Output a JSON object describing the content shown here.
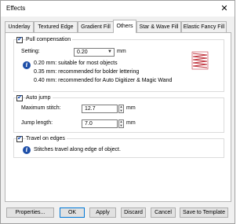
{
  "window": {
    "title": "Effects",
    "close_glyph": "✕"
  },
  "tabs": [
    {
      "label": "Underlay"
    },
    {
      "label": "Textured Edge"
    },
    {
      "label": "Gradient Fill"
    },
    {
      "label": "Others"
    },
    {
      "label": "Star & Wave Fill"
    },
    {
      "label": "Elastic Fancy Fill"
    }
  ],
  "active_tab": "Others",
  "pull_compensation": {
    "checkbox_label": "Pull compensation",
    "checked": true,
    "setting_label": "Setting:",
    "setting_value": "0.20",
    "unit": "mm",
    "info_lines": [
      "0.20 mm: suitable for most objects",
      "0.35 mm: recommended for bolder lettering",
      "0.40 mm: recommended for Auto Digitizer & Magic Wand"
    ],
    "preview_icon": "zigzag-stitch-preview-icon"
  },
  "auto_jump": {
    "checkbox_label": "Auto jump",
    "checked": true,
    "max_stitch_label": "Maximum stitch:",
    "max_stitch_value": "12.7",
    "jump_length_label": "Jump length:",
    "jump_length_value": "7.0",
    "unit": "mm"
  },
  "travel_on_edges": {
    "checkbox_label": "Travel on edges",
    "checked": true,
    "info_text": "Stitches travel along edge of object."
  },
  "buttons": {
    "properties": "Properties...",
    "ok": "OK",
    "apply": "Apply",
    "discard": "Discard",
    "cancel": "Cancel",
    "save_to_template": "Save to Template"
  },
  "colors": {
    "accent": "#1e4fa8",
    "preview_stitch": "#c0303a",
    "check": "#1a4fb0"
  }
}
